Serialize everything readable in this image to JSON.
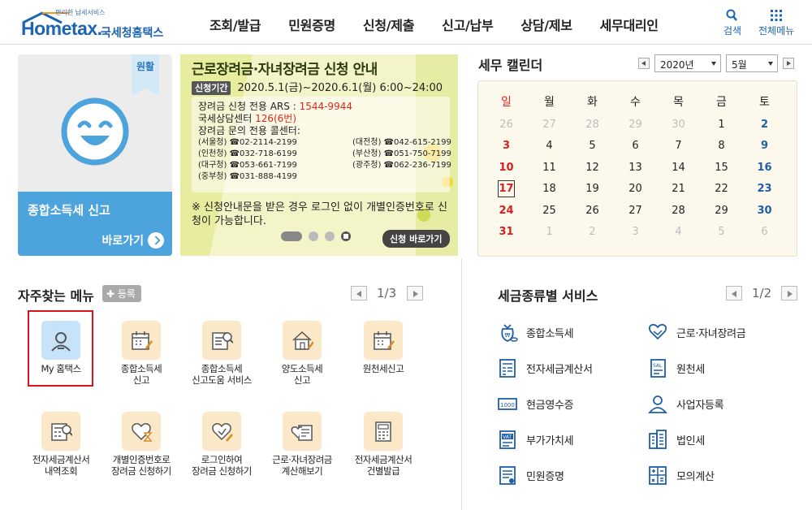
{
  "header": {
    "logo_tagline": "편리한 납세서비스",
    "logo_word_home": "Home",
    "logo_word_tax": "tax.",
    "logo_kr": "국세청홈택스",
    "nav": [
      "조회/발급",
      "민원증명",
      "신청/제출",
      "신고/납부",
      "상담/제보",
      "세무대리인"
    ],
    "search_label": "검색",
    "menu_label": "전체메뉴"
  },
  "promo": {
    "ribbon": "원활",
    "title": "종합소득세 신고",
    "link": "바로가기"
  },
  "banner": {
    "title": "근로장려금·자녀장려금 신청 안내",
    "period_label": "신청기간",
    "period": "2020.5.1(금)~2020.6.1(월) 6:00~24:00",
    "ars_label": "장려금 신청 전용 ARS : ",
    "ars_number": "1544-9944",
    "center_label": "국세상담센터 ",
    "center_number": "126(6번)",
    "callcenter_label": "장려금 문의 전용 콜센터:",
    "callcenters": [
      "(서울청) ☎02-2114-2199",
      "(대전청) ☎042-615-2199",
      "(인천청) ☎032-718-6199",
      "(부산청) ☎051-750-7199",
      "(대구청) ☎053-661-7199",
      "(광주청) ☎062-236-7199",
      "(중부청) ☎031-888-4199"
    ],
    "note": "※ 신청안내문을 받은 경우 로그인 없이 개별인증번호로 신청이 가능합니다.",
    "apply": "신청 바로가기"
  },
  "calendar": {
    "title": "세무 캘린더",
    "year": "2020년",
    "month": "5월",
    "weekdays": [
      "일",
      "월",
      "화",
      "수",
      "목",
      "금",
      "토"
    ],
    "weeks": [
      [
        "26",
        "27",
        "28",
        "29",
        "30",
        "1",
        "2"
      ],
      [
        "3",
        "4",
        "5",
        "6",
        "7",
        "8",
        "9"
      ],
      [
        "10",
        "11",
        "12",
        "13",
        "14",
        "15",
        "16"
      ],
      [
        "17",
        "18",
        "19",
        "20",
        "21",
        "22",
        "23"
      ],
      [
        "24",
        "25",
        "26",
        "27",
        "28",
        "29",
        "30"
      ],
      [
        "31",
        "1",
        "2",
        "3",
        "4",
        "5",
        "6"
      ]
    ],
    "today": "17"
  },
  "favorites": {
    "title": "자주찾는 메뉴",
    "register": "등록",
    "page": "1/3",
    "items": [
      {
        "label": "My 홈택스",
        "icon": "my-hometax-icon"
      },
      {
        "label": "종합소득세\n신고",
        "icon": "calendar-pen-icon"
      },
      {
        "label": "종합소득세\n신고도움 서비스",
        "icon": "document-search-icon"
      },
      {
        "label": "양도소득세\n신고",
        "icon": "house-pen-icon"
      },
      {
        "label": "원천세신고",
        "icon": "calendar-pen-icon"
      },
      {
        "label": "전자세금계산서\n내역조회",
        "icon": "calculator-search-icon"
      },
      {
        "label": "개별인증번호로\n장려금 신청하기",
        "icon": "heart-hourglass-icon"
      },
      {
        "label": "로그인하여\n장려금 신청하기",
        "icon": "heart-pen-icon"
      },
      {
        "label": "근로·자녀장려금\n계산해보기",
        "icon": "heart-document-icon"
      },
      {
        "label": "전자세금계산서\n건별발급",
        "icon": "calculator-icon"
      }
    ]
  },
  "tax_services": {
    "title": "세금종류별 서비스",
    "page": "1/2",
    "items": [
      {
        "label": "종합소득세",
        "icon": "money-bag-icon"
      },
      {
        "label": "근로·자녀장려금",
        "icon": "heart-hand-icon"
      },
      {
        "label": "전자세금계산서",
        "icon": "calculator-doc-icon"
      },
      {
        "label": "원천세",
        "icon": "salary-doc-icon"
      },
      {
        "label": "현금영수증",
        "icon": "receipt-1000-icon"
      },
      {
        "label": "사업자등록",
        "icon": "person-icon"
      },
      {
        "label": "부가가치세",
        "icon": "vat-doc-icon"
      },
      {
        "label": "법인세",
        "icon": "building-icon"
      },
      {
        "label": "민원증명",
        "icon": "certificate-doc-icon"
      },
      {
        "label": "모의계산",
        "icon": "calculator-ops-icon"
      }
    ]
  },
  "colors": {
    "brand": "#1e64b4",
    "sunday": "#d62020",
    "saturday": "#1f5fa8",
    "highlight_border": "#d7151b"
  }
}
